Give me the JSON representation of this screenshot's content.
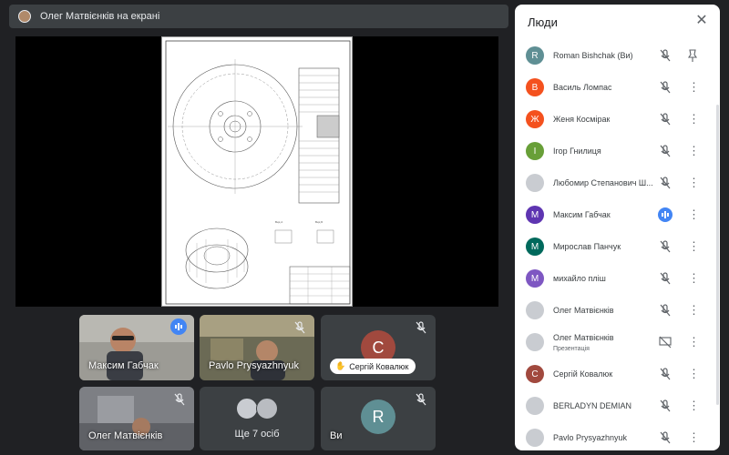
{
  "banner": {
    "text": "Олег Матвієнків на екрані"
  },
  "tiles": {
    "maksym": {
      "name": "Максим Габчак"
    },
    "pavlo": {
      "name": "Pavlo Prysyazhnyuk"
    },
    "serhii": {
      "initial": "С",
      "chip": "Сергій Ковалюк",
      "color": "#a1493e"
    },
    "oleh": {
      "name": "Олег Матвієнків"
    },
    "more": {
      "label": "Ще 7 осіб"
    },
    "self": {
      "initial": "R",
      "name": "Ви",
      "color": "#5f8f94"
    }
  },
  "people": {
    "title": "Люди",
    "list": [
      {
        "name": "Roman Bishchak (Ви)",
        "initial": "R",
        "color": "#5f8f94",
        "action": "pin"
      },
      {
        "name": "Василь Ломпас",
        "initial": "В",
        "color": "#f4511e",
        "action": "more"
      },
      {
        "name": "Женя Космірак",
        "initial": "Ж",
        "color": "#f4511e",
        "action": "more"
      },
      {
        "name": "Ігор Гнилиця",
        "initial": "І",
        "color": "#689f38",
        "action": "more"
      },
      {
        "name": "Любомир Степанович Ш...",
        "initial": "",
        "color": "#c9ccd1",
        "action": "more",
        "photo": true
      },
      {
        "name": "Максим Габчак",
        "initial": "М",
        "color": "#5e35b1",
        "action": "more",
        "speaking": true
      },
      {
        "name": "Мирослав Панчук",
        "initial": "М",
        "color": "#00695c",
        "action": "more"
      },
      {
        "name": "михайло пліш",
        "initial": "М",
        "color": "#7e57c2",
        "action": "more"
      },
      {
        "name": "Олег Матвієнків",
        "initial": "",
        "color": "#c9ccd1",
        "action": "more",
        "photo": true
      },
      {
        "name": "Олег Матвієнків",
        "sub": "Презентація",
        "initial": "",
        "color": "#c9ccd1",
        "action": "more",
        "photo": true,
        "present": true
      },
      {
        "name": "Сергій Ковалюк",
        "initial": "С",
        "color": "#a1493e",
        "action": "more"
      },
      {
        "name": "BERLADYN DEMIAN",
        "initial": "",
        "color": "#c9ccd1",
        "action": "more",
        "photo": true
      },
      {
        "name": "Pavlo Prysyazhnyuk",
        "initial": "",
        "color": "#c9ccd1",
        "action": "more",
        "photo": true
      }
    ]
  }
}
